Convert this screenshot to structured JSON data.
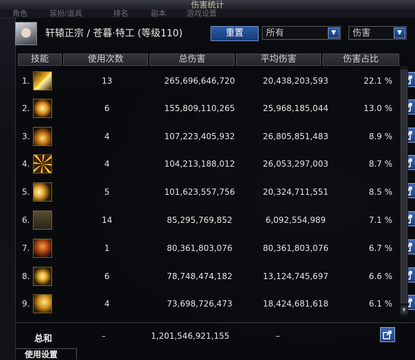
{
  "window": {
    "title": "伤害统计"
  },
  "bg_tabs": [
    "角色",
    "装扮/道具",
    "排名",
    "副本",
    "游戏设置"
  ],
  "header": {
    "character": "轩辕正宗 / 苍暮·特工 (等级110)",
    "reset_label": "重置",
    "filter_target": "所有",
    "filter_type": "伤害"
  },
  "columns": {
    "skill": "技能",
    "uses": "使用次数",
    "total": "总伤害",
    "avg": "平均伤害",
    "pct": "伤害占比"
  },
  "rows": [
    {
      "rank": "1.",
      "icon": "skill-icon-1",
      "uses": "13",
      "total": "265,696,646,720",
      "avg": "20,438,203,593",
      "pct": "22.1 %"
    },
    {
      "rank": "2.",
      "icon": "skill-icon-2",
      "uses": "6",
      "total": "155,809,110,265",
      "avg": "25,968,185,044",
      "pct": "13.0 %"
    },
    {
      "rank": "3.",
      "icon": "skill-icon-3",
      "uses": "4",
      "total": "107,223,405,932",
      "avg": "26,805,851,483",
      "pct": "8.9 %"
    },
    {
      "rank": "4.",
      "icon": "skill-icon-4",
      "uses": "4",
      "total": "104,213,188,012",
      "avg": "26,053,297,003",
      "pct": "8.7 %"
    },
    {
      "rank": "5.",
      "icon": "skill-icon-5",
      "uses": "5",
      "total": "101,623,557,756",
      "avg": "20,324,711,551",
      "pct": "8.5 %"
    },
    {
      "rank": "6.",
      "icon": "skill-icon-6",
      "uses": "14",
      "total": "85,295,769,852",
      "avg": "6,092,554,989",
      "pct": "7.1 %"
    },
    {
      "rank": "7.",
      "icon": "skill-icon-7",
      "uses": "1",
      "total": "80,361,803,076",
      "avg": "80,361,803,076",
      "pct": "6.7 %"
    },
    {
      "rank": "8.",
      "icon": "skill-icon-8",
      "uses": "6",
      "total": "78,748,474,182",
      "avg": "13,124,745,697",
      "pct": "6.6 %"
    },
    {
      "rank": "9.",
      "icon": "skill-icon-9",
      "uses": "4",
      "total": "73,698,726,473",
      "avg": "18,424,681,618",
      "pct": "6.1 %"
    }
  ],
  "total": {
    "label": "总和",
    "uses": "–",
    "total": "1,201,546,921,155",
    "avg": "–"
  },
  "footer": {
    "settings_tab": "使用设置"
  },
  "colors": {
    "button_blue": "#2c5da8",
    "header_bg": "#2a2c32",
    "icon_gold": "#e0a020"
  }
}
